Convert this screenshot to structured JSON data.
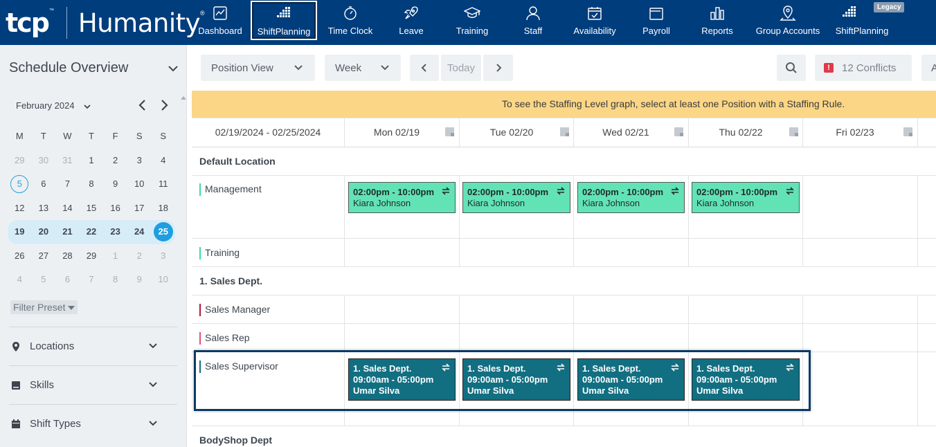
{
  "brand": {
    "tcp": "tcp",
    "tm": "™",
    "name": "Humanity",
    "reg": "®"
  },
  "nav": [
    {
      "label": "Dashboard",
      "icon": "dashboard-icon"
    },
    {
      "label": "ShiftPlanning",
      "icon": "shiftplanning-icon",
      "active": true
    },
    {
      "label": "Time Clock",
      "icon": "stopwatch-icon"
    },
    {
      "label": "Leave",
      "icon": "rocket-icon"
    },
    {
      "label": "Training",
      "icon": "graduation-cap-icon"
    },
    {
      "label": "Staff",
      "icon": "person-icon"
    },
    {
      "label": "Availability",
      "icon": "calendar-check-icon"
    },
    {
      "label": "Payroll",
      "icon": "wallet-icon"
    },
    {
      "label": "Reports",
      "icon": "bar-chart-icon"
    },
    {
      "label": "Group Accounts",
      "icon": "map-pin-icon"
    },
    {
      "label": "ShiftPlanning",
      "icon": "shiftplanning-icon",
      "badge": "Legacy"
    }
  ],
  "sidebar": {
    "title": "Schedule Overview",
    "month": "February 2024",
    "weekdays": [
      "M",
      "T",
      "W",
      "T",
      "F",
      "S",
      "S"
    ],
    "weeks": [
      [
        "29",
        "30",
        "31",
        "1",
        "2",
        "3",
        "4"
      ],
      [
        "5",
        "6",
        "7",
        "8",
        "9",
        "10",
        "11"
      ],
      [
        "12",
        "13",
        "14",
        "15",
        "16",
        "17",
        "18"
      ],
      [
        "19",
        "20",
        "21",
        "22",
        "23",
        "24",
        "25"
      ],
      [
        "26",
        "27",
        "28",
        "29",
        "1",
        "2",
        "3"
      ],
      [
        "4",
        "5",
        "6",
        "7",
        "8",
        "9",
        "10"
      ]
    ],
    "filter_preset": "Filter Preset",
    "sections": [
      "Locations",
      "Skills",
      "Shift Types"
    ]
  },
  "toolbar": {
    "view": "Position View",
    "range": "Week",
    "today": "Today",
    "conflicts_badge": "!",
    "conflicts": "12 Conflicts",
    "extra": "A"
  },
  "banner": "To see the Staffing Level graph, select at least one Position with a Staffing Rule.",
  "schedule": {
    "range_label": "02/19/2024 - 02/25/2024",
    "days": [
      "Mon 02/19",
      "Tue 02/20",
      "Wed 02/21",
      "Thu 02/22",
      "Fri 02/23"
    ],
    "groups": [
      {
        "name": "Default Location"
      },
      {
        "name": "1. Sales Dept."
      },
      {
        "name": "BodyShop Dept"
      }
    ],
    "positions": [
      {
        "name": "Management",
        "color": "#3dd9a6"
      },
      {
        "name": "Training",
        "color": "#3dd9a6"
      },
      {
        "name": "Sales Manager",
        "color": "#b0163c"
      },
      {
        "name": "Sales Rep",
        "color": "#e04e7a"
      },
      {
        "name": "Sales Supervisor",
        "color": "#126f82"
      }
    ],
    "management_shifts": [
      {
        "time": "02:00pm - 10:00pm",
        "employee": "Kiara Johnson"
      },
      {
        "time": "02:00pm - 10:00pm",
        "employee": "Kiara Johnson"
      },
      {
        "time": "02:00pm - 10:00pm",
        "employee": "Kiara Johnson"
      },
      {
        "time": "02:00pm - 10:00pm",
        "employee": "Kiara Johnson"
      }
    ],
    "supervisor_shifts": [
      {
        "dept": "1. Sales Dept.",
        "time": "09:00am - 05:00pm",
        "employee": "Umar Silva"
      },
      {
        "dept": "1. Sales Dept.",
        "time": "09:00am - 05:00pm",
        "employee": "Umar Silva"
      },
      {
        "dept": "1. Sales Dept.",
        "time": "09:00am - 05:00pm",
        "employee": "Umar Silva"
      },
      {
        "dept": "1. Sales Dept.",
        "time": "09:00am - 05:00pm",
        "employee": "Umar Silva"
      }
    ]
  }
}
